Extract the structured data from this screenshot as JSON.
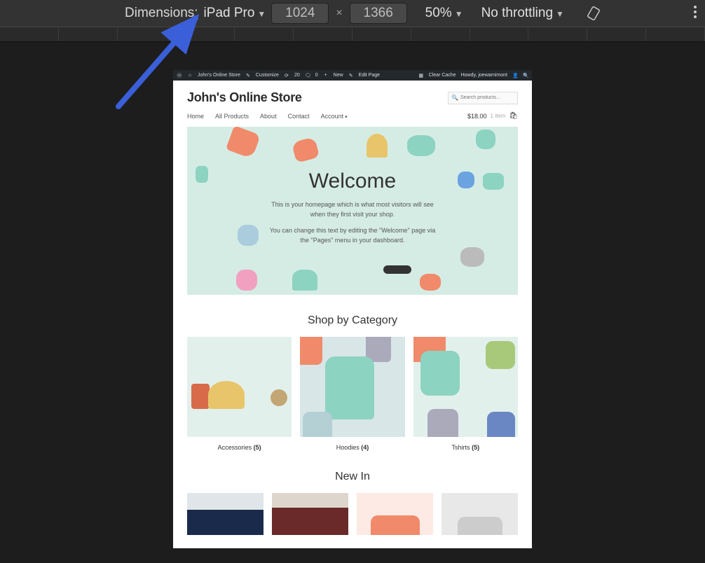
{
  "devtools": {
    "dimensions_label": "Dimensions:",
    "device": "iPad Pro",
    "width": "1024",
    "height": "1366",
    "zoom": "50%",
    "throttling": "No throttling"
  },
  "wp_admin": {
    "site_name": "John's Online Store",
    "customize": "Customize",
    "updates_count": "20",
    "comments_count": "0",
    "new": "New",
    "edit_page": "Edit Page",
    "clear_cache": "Clear Cache",
    "howdy": "Howdy, joewarnimont"
  },
  "site": {
    "title": "John's Online Store",
    "search_placeholder": "Search products…",
    "nav": {
      "home": "Home",
      "all_products": "All Products",
      "about": "About",
      "contact": "Contact",
      "account": "Account"
    },
    "cart": {
      "price": "$18.00",
      "items": "1 item"
    }
  },
  "hero": {
    "title": "Welcome",
    "p1": "This is your homepage which is what most visitors will see when they first visit your shop.",
    "p2": "You can change this text by editing the \"Welcome\" page via the \"Pages\" menu in your dashboard."
  },
  "shop_by_category": {
    "title": "Shop by Category",
    "cats": [
      {
        "name": "Accessories",
        "count": "(5)"
      },
      {
        "name": "Hoodies",
        "count": "(4)"
      },
      {
        "name": "Tshirts",
        "count": "(5)"
      }
    ]
  },
  "new_in": {
    "title": "New In"
  }
}
